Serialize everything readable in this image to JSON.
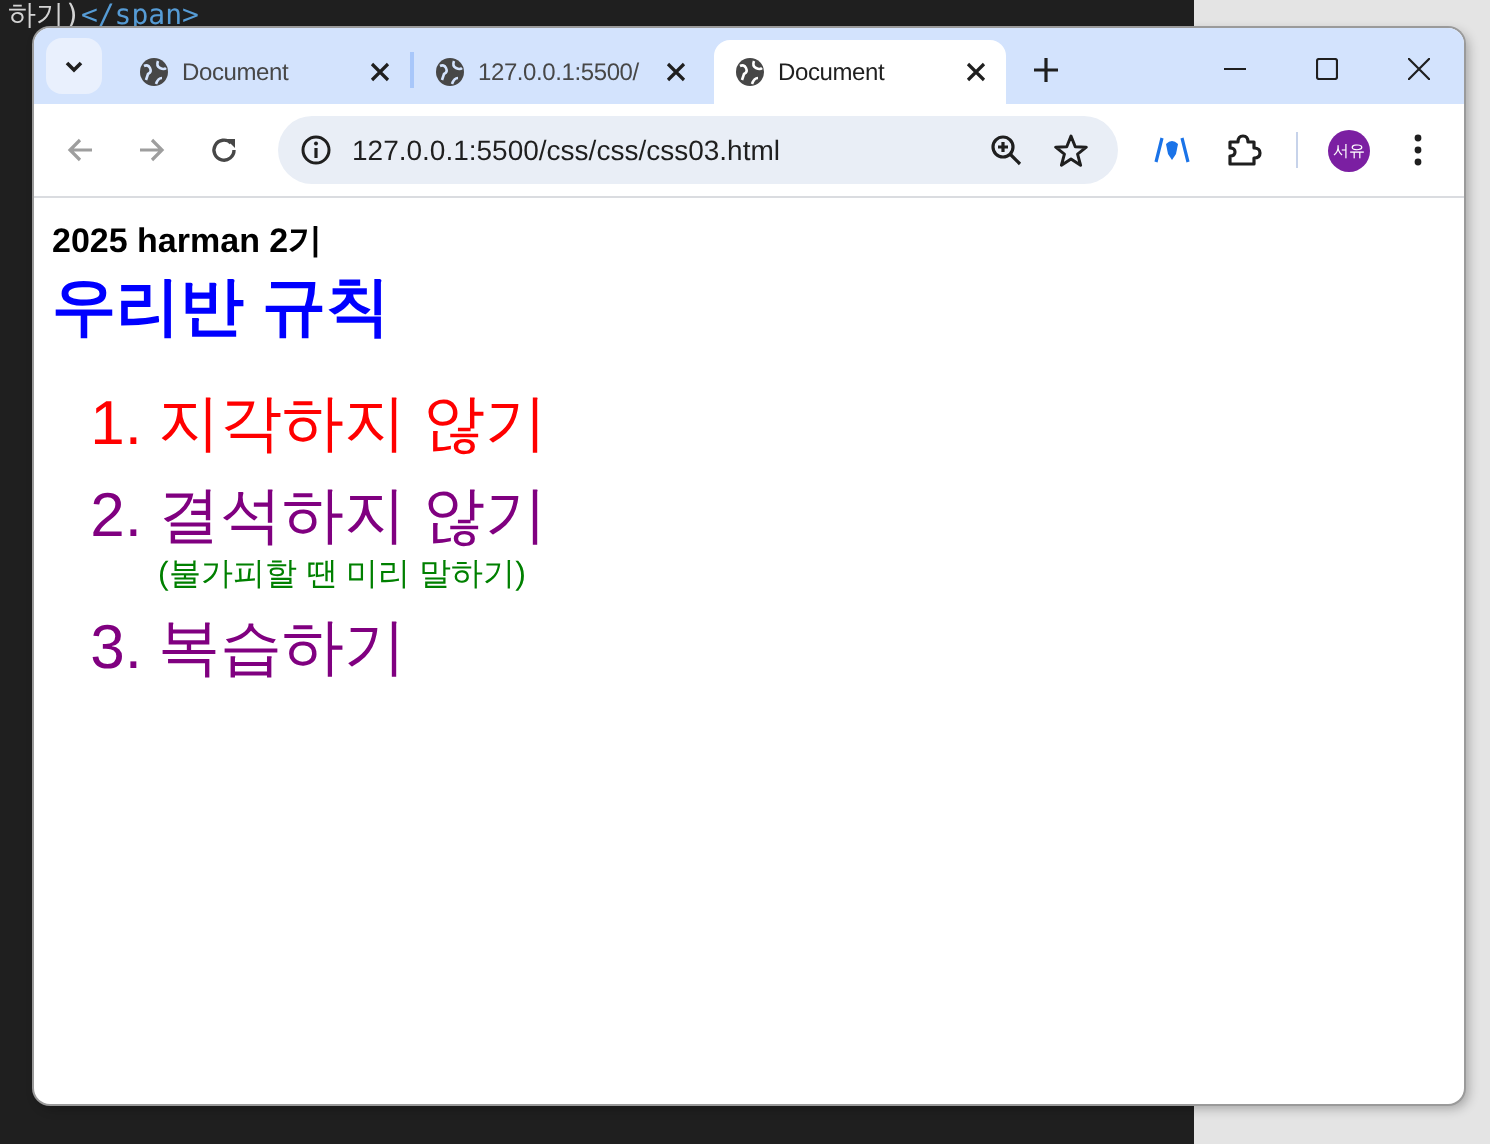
{
  "editor": {
    "line_text": "하기)",
    "line_tag": "</span>"
  },
  "browser": {
    "tabs": [
      {
        "title": "Document",
        "selected": false
      },
      {
        "title": "127.0.0.1:5500/",
        "selected": false
      },
      {
        "title": "Document",
        "selected": true
      }
    ],
    "nav": {
      "back_disabled": true,
      "forward_disabled": true
    },
    "address": "127.0.0.1:5500/css/css/css03.html",
    "profile": "서유"
  },
  "page": {
    "subtitle": "2025 harman 2기",
    "title": "우리반 규칙",
    "rules": [
      {
        "number": "1.",
        "text": "지각하지 않기",
        "color": "#ff0000"
      },
      {
        "number": "2.",
        "text": "결석하지 않기",
        "color": "#800080",
        "note": "(불가피할 땐 미리 말하기)"
      },
      {
        "number": "3.",
        "text": "복습하기",
        "color": "#800080"
      }
    ]
  }
}
